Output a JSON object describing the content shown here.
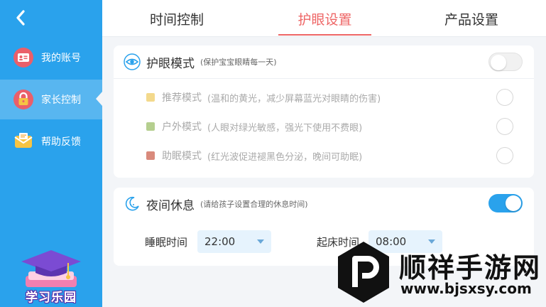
{
  "sidebar": {
    "items": [
      {
        "label": "我的账号",
        "icon": "account-card-icon"
      },
      {
        "label": "家长控制",
        "icon": "lock-icon",
        "active": true
      },
      {
        "label": "帮助反馈",
        "icon": "mail-icon"
      }
    ],
    "mascot_label": "学习乐园"
  },
  "tabs": [
    {
      "label": "时间控制"
    },
    {
      "label": "护眼设置",
      "active": true
    },
    {
      "label": "产品设置"
    }
  ],
  "eye_card": {
    "title": "护眼模式",
    "subtitle": "(保护宝宝眼睛每一天)",
    "enabled": false,
    "modes": [
      {
        "name": "推荐模式",
        "desc": "(温和的黄光，减少屏幕蓝光对眼睛的伤害)",
        "color": "#f3d98c"
      },
      {
        "name": "户外模式",
        "desc": "(人眼对绿光敏感，强光下使用不费眼)",
        "color": "#b5cf8f"
      },
      {
        "name": "助眠模式",
        "desc": "(红光波促进褪黑色分泌，晚间可助眠)",
        "color": "#d98a7c"
      }
    ]
  },
  "night_card": {
    "title": "夜间休息",
    "subtitle": "(请给孩子设置合理的休息时间)",
    "enabled": true,
    "sleep_label": "睡眠时间",
    "sleep_value": "22:00",
    "wake_label": "起床时间",
    "wake_value": "08:00"
  },
  "watermark": {
    "title": "顺祥手游网",
    "url": "www.bjsxsy.com"
  },
  "colors": {
    "sidebar": "#2aa2ec",
    "accent": "#ee6666",
    "toggle_on": "#2aa2ec"
  }
}
